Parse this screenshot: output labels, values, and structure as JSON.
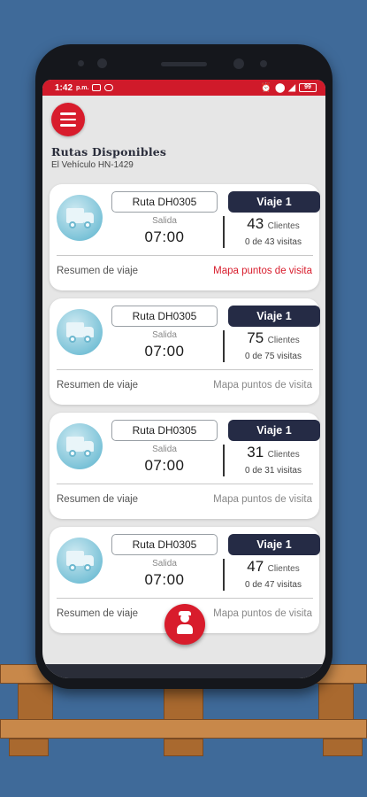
{
  "status_bar": {
    "time": "1:42",
    "ampm": "p.m.",
    "battery": "99"
  },
  "page": {
    "title": "Rutas Disponibles",
    "subtitle": "El Vehículo HN-1429"
  },
  "cards": [
    {
      "route": "Ruta DH0305",
      "trip": "Viaje 1",
      "departure_label": "Salida",
      "departure_time": "07:00",
      "clients": "43",
      "clients_label": "Clientes",
      "visits": "0 de 43 visitas",
      "summary": "Resumen de viaje",
      "map": "Mapa puntos de visita",
      "map_active": true
    },
    {
      "route": "Ruta DH0305",
      "trip": "Viaje 1",
      "departure_label": "Salida",
      "departure_time": "07:00",
      "clients": "75",
      "clients_label": "Clientes",
      "visits": "0 de 75 visitas",
      "summary": "Resumen de viaje",
      "map": "Mapa puntos de visita",
      "map_active": false
    },
    {
      "route": "Ruta DH0305",
      "trip": "Viaje 1",
      "departure_label": "Salida",
      "departure_time": "07:00",
      "clients": "31",
      "clients_label": "Clientes",
      "visits": "0 de 31 visitas",
      "summary": "Resumen de viaje",
      "map": "Mapa puntos de visita",
      "map_active": false
    },
    {
      "route": "Ruta DH0305",
      "trip": "Viaje 1",
      "departure_label": "Salida",
      "departure_time": "07:00",
      "clients": "47",
      "clients_label": "Clientes",
      "visits": "0 de 47 visitas",
      "summary": "Resumen de viaje",
      "map": "Mapa puntos de visita",
      "map_active": false
    }
  ],
  "icons": {
    "menu": "hamburger-menu-icon",
    "truck": "truck-icon",
    "fab": "driver-icon"
  },
  "colors": {
    "accent": "#d81c2c",
    "trip_badge": "#252b45",
    "background": "#3f6a99"
  }
}
